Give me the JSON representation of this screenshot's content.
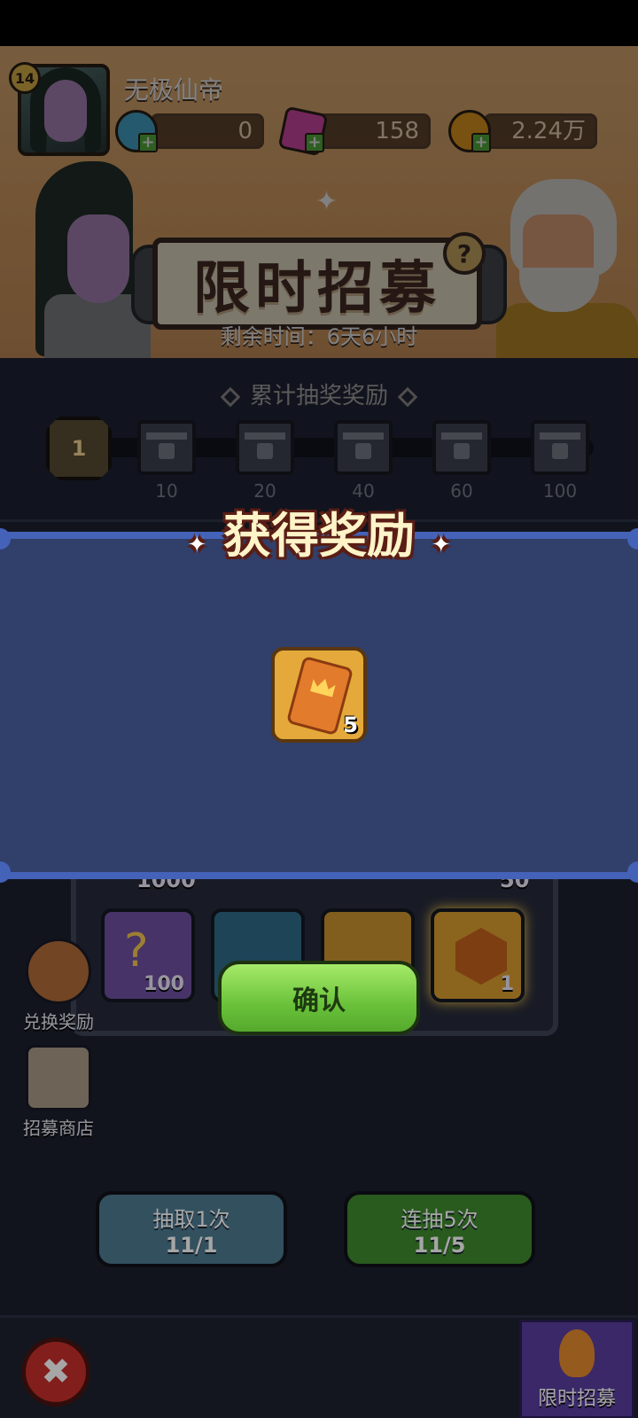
{
  "player": {
    "level": "14",
    "name": "无极仙帝"
  },
  "resources": [
    {
      "name": "blue-gem",
      "value": "0",
      "color": "#4bb0d8"
    },
    {
      "name": "pink-crystal",
      "value": "158",
      "color": "#e24fb2"
    },
    {
      "name": "gold-coin",
      "value": "2.24万",
      "color": "#f0a020"
    }
  ],
  "banner": {
    "title": "限时招募",
    "help": "?",
    "timer": "剩余时间：6天6小时"
  },
  "cumulative": {
    "title": "累计抽奖奖励",
    "current": "1",
    "milestones": [
      "10",
      "20",
      "40",
      "60",
      "100"
    ]
  },
  "grid": {
    "top_values": [
      "1000",
      "50"
    ],
    "cards": [
      {
        "name": "puzzle-piece",
        "count": "100",
        "color": "#6d4f9e"
      },
      {
        "name": "scroll",
        "count": "",
        "color": "#2f6a86"
      },
      {
        "name": "book",
        "count": "",
        "color": "#c8912e"
      },
      {
        "name": "gold-gem",
        "count": "1",
        "color": "#d69a2e"
      }
    ]
  },
  "side": {
    "exchange": "兑换奖励",
    "shop": "招募商店"
  },
  "pull": {
    "single_label": "抽取1次",
    "single_cost": "11/1",
    "multi_label": "连抽5次",
    "multi_cost": "11/5"
  },
  "footer": {
    "close": "✖",
    "tab_label": "限时招募"
  },
  "modal": {
    "title": "获得奖励",
    "reward_count": "5",
    "confirm": "确认"
  }
}
